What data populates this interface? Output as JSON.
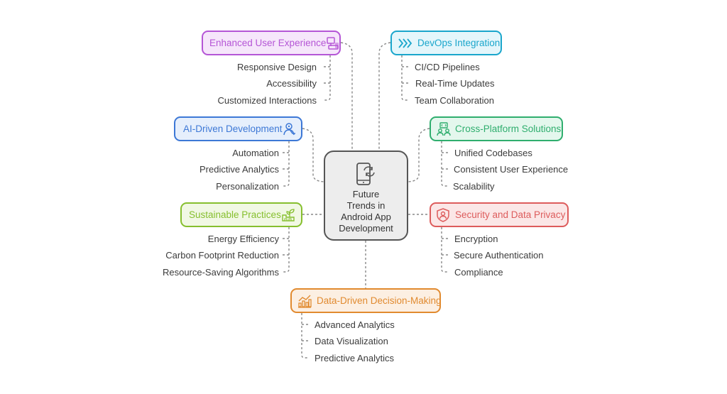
{
  "center": {
    "title_lines": [
      "Future",
      "Trends in",
      "Android App",
      "Development"
    ],
    "icon": "phone-refresh-icon"
  },
  "branches": [
    {
      "id": "enhanced-user-experience",
      "label": "Enhanced User Experience",
      "icon": "devices-icon",
      "color": "#b556d6",
      "fill": "#f6e6fb",
      "items": [
        "Responsive Design",
        "Accessibility",
        "Customized Interactions"
      ]
    },
    {
      "id": "devops-integration",
      "label": "DevOps Integration",
      "icon": "double-chevron-right-icon",
      "color": "#1aa6cc",
      "fill": "#e4f6fb",
      "items": [
        "CI/CD Pipelines",
        "Real-Time Updates",
        "Team Collaboration"
      ]
    },
    {
      "id": "ai-driven-development",
      "label": "AI-Driven Development",
      "icon": "ai-person-icon",
      "color": "#3d78d6",
      "fill": "#e6effc",
      "items": [
        "Automation",
        "Predictive Analytics",
        "Personalization"
      ]
    },
    {
      "id": "cross-platform-solutions",
      "label": "Cross-Platform Solutions",
      "icon": "code-team-icon",
      "color": "#2fae6e",
      "fill": "#e4f7ed",
      "items": [
        "Unified Codebases",
        "Consistent User Experience",
        "Scalability"
      ]
    },
    {
      "id": "sustainable-practices",
      "label": "Sustainable Practices",
      "icon": "eco-factory-icon",
      "color": "#86bf2e",
      "fill": "#f1f8e4",
      "items": [
        "Energy Efficiency",
        "Carbon Footprint Reduction",
        "Resource-Saving Algorithms"
      ]
    },
    {
      "id": "security-and-data-privacy",
      "label": "Security and Data Privacy",
      "icon": "shield-user-icon",
      "color": "#dd5c5c",
      "fill": "#fbe7e7",
      "items": [
        "Encryption",
        "Secure Authentication",
        "Compliance"
      ]
    },
    {
      "id": "data-driven-decision-making",
      "label": "Data-Driven Decision-Making",
      "icon": "bar-chart-trend-icon",
      "color": "#e18a2f",
      "fill": "#fcefe2",
      "items": [
        "Advanced Analytics",
        "Data Visualization",
        "Predictive Analytics"
      ]
    }
  ]
}
